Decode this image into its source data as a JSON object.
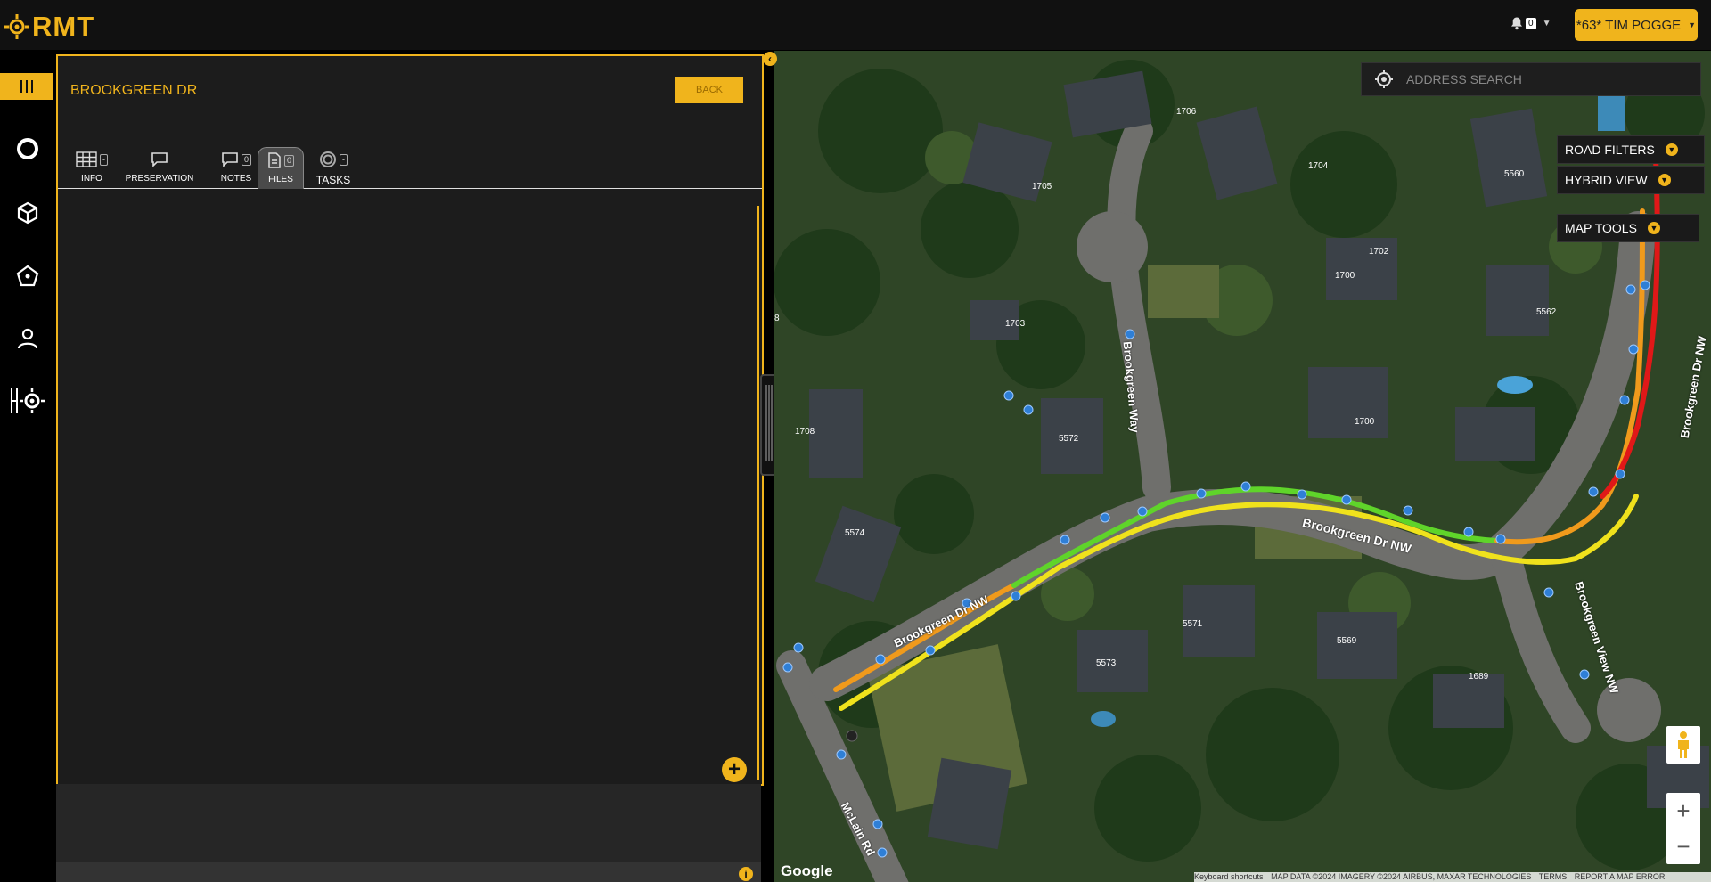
{
  "app": {
    "logo_text": "RMT"
  },
  "header": {
    "notifications_count": "0",
    "user_label": "*63* TIM POGGE"
  },
  "panel": {
    "title": "BROOKGREEN DR",
    "back_label": "BACK",
    "tabs": [
      {
        "label": "INFO",
        "count": "-",
        "icon": "grid-icon"
      },
      {
        "label": "PRESERVATION",
        "count": "",
        "icon": "chat-icon"
      },
      {
        "label": "NOTES",
        "count": "0",
        "icon": "chat-icon"
      },
      {
        "label": "FILES",
        "count": "0",
        "icon": "file-icon",
        "active": true
      },
      {
        "label": "TASKS",
        "count": "-",
        "icon": "target-icon"
      }
    ],
    "add_label": "+"
  },
  "map": {
    "search_placeholder": "ADDRESS SEARCH",
    "controls": {
      "road_filters": "ROAD FILTERS",
      "hybrid_view": "HYBRID VIEW",
      "map_tools": "MAP TOOLS"
    },
    "street_labels": [
      "Brookgreen Way",
      "Brookgreen Dr NW",
      "Brookgreen Dr NW",
      "Brookgreen Dr NW",
      "Brookgreen View NW",
      "McLain Rd"
    ],
    "house_numbers": [
      "1706",
      "1705",
      "1704",
      "1702",
      "1700",
      "1703",
      "5560",
      "5562",
      "8",
      "1700",
      "1708",
      "5572",
      "5574",
      "5571",
      "5569",
      "5573",
      "1689"
    ],
    "google_label": "Google",
    "attribution": [
      "Keyboard shortcuts",
      "MAP DATA ©2024 IMAGERY ©2024 AIRBUS, MAXAR TECHNOLOGIES",
      "TERMS",
      "REPORT A MAP ERROR"
    ],
    "zoom_in": "+",
    "zoom_out": "−"
  },
  "colors": {
    "accent": "#f0b41c",
    "good": "#5fd42a",
    "fair": "#f0e21c",
    "poor": "#f09a1c",
    "bad": "#e01818",
    "marker": "#2f7fd6"
  }
}
